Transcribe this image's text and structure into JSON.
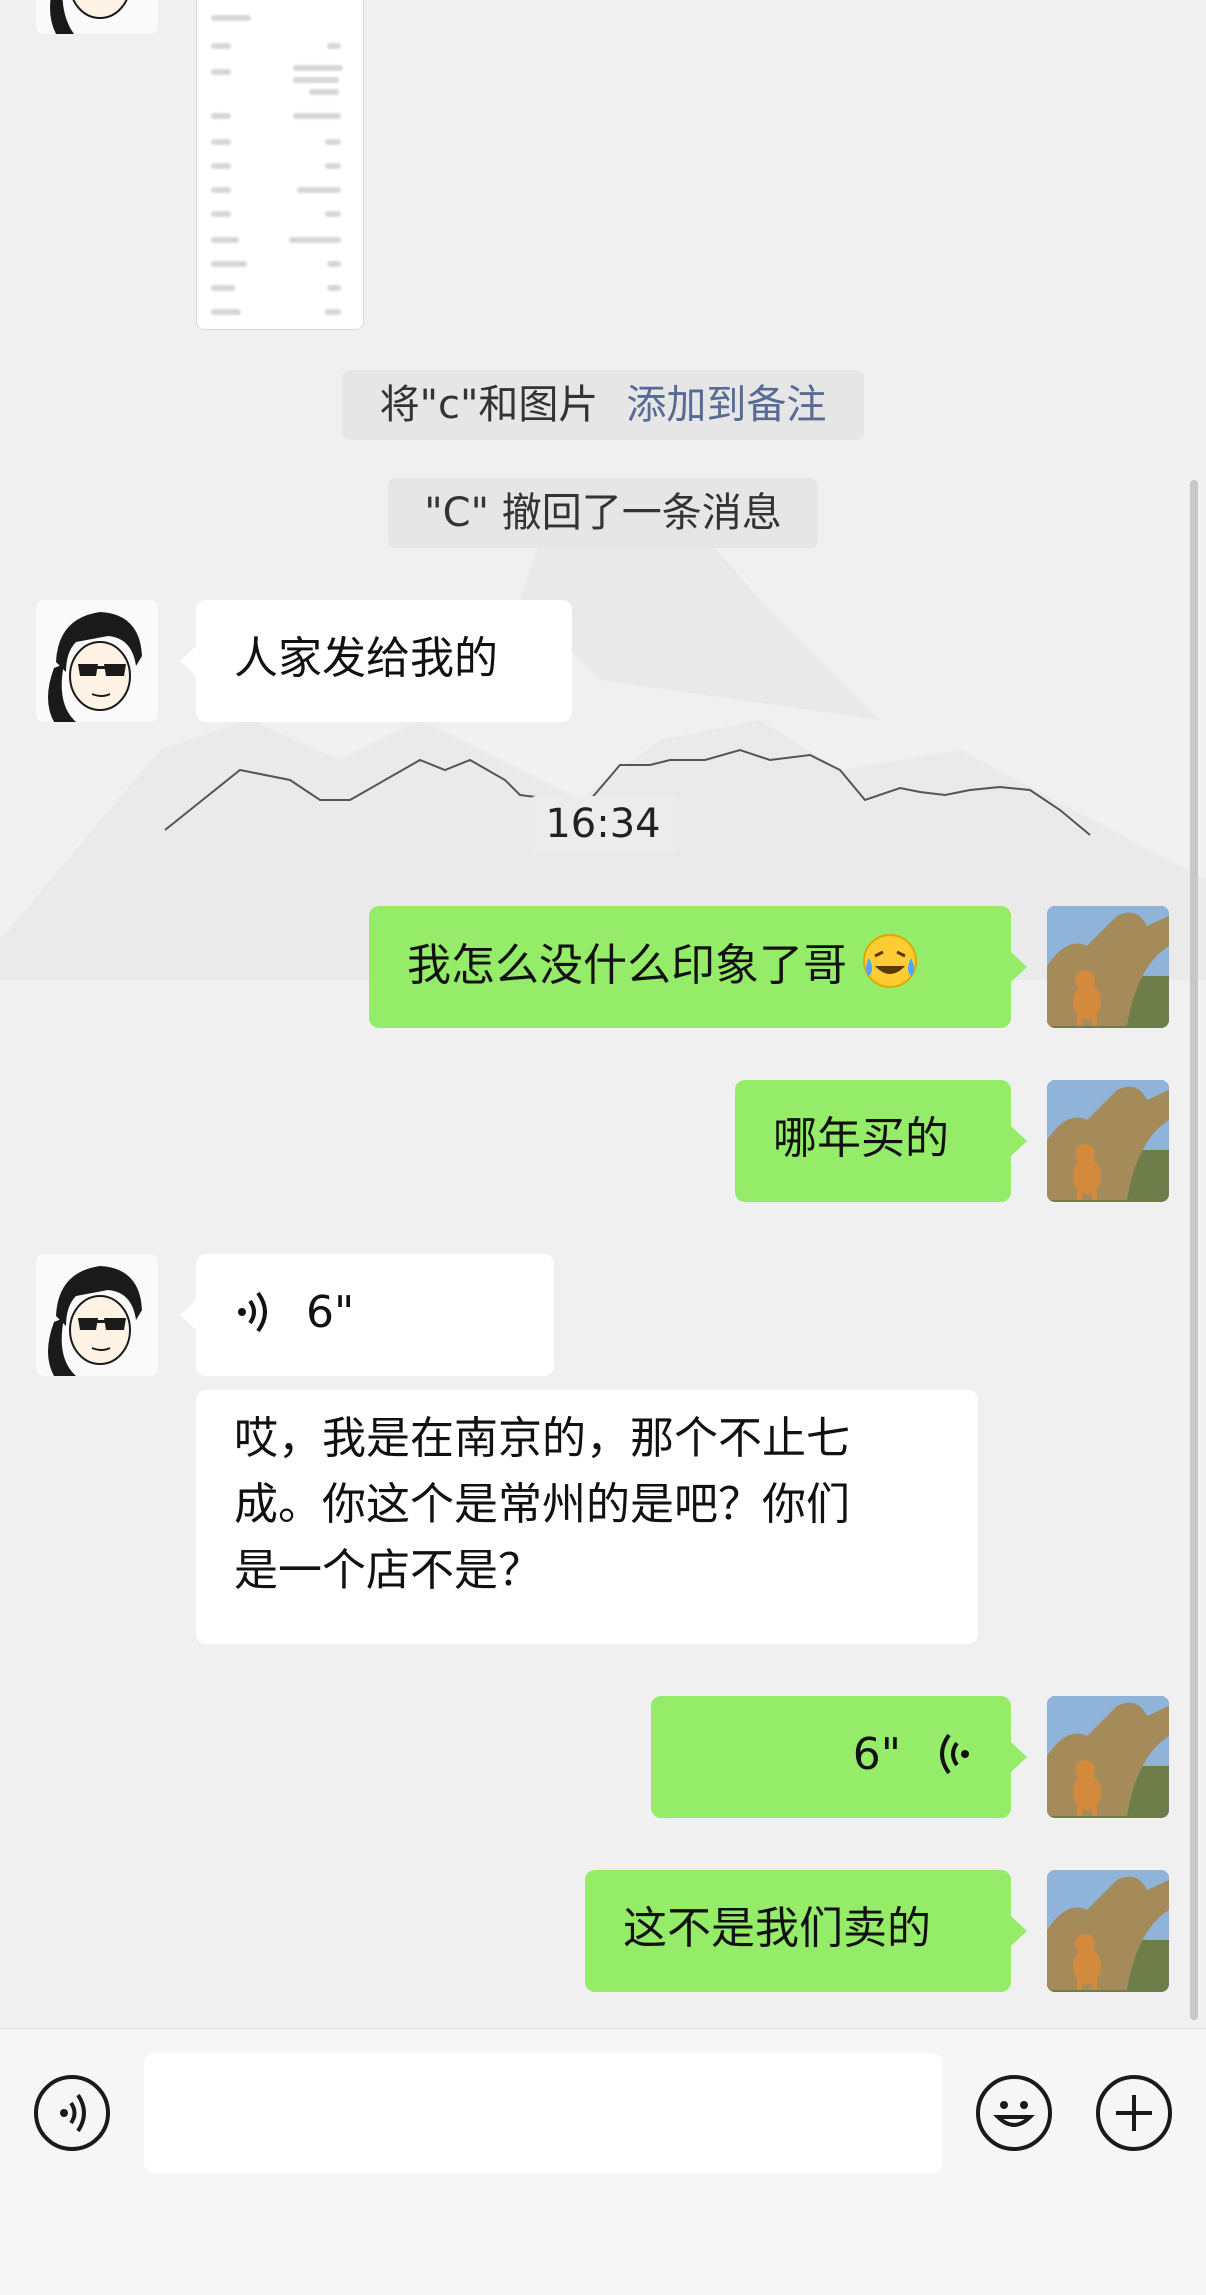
{
  "system": {
    "remark_prefix": "将\"c\"和图片",
    "remark_link": "添加到备注",
    "recalled": "\"C\" 撤回了一条消息",
    "timestamp": "16:34"
  },
  "messages": [
    {
      "from": "other",
      "type": "text",
      "text": "人家发给我的"
    },
    {
      "from": "me",
      "type": "text",
      "text": "我怎么没什么印象了哥",
      "emoji": "crying-laughing-emoji"
    },
    {
      "from": "me",
      "type": "text",
      "text": "哪年买的"
    },
    {
      "from": "other",
      "type": "voice",
      "duration": "6\""
    },
    {
      "from": "other",
      "type": "text",
      "lines": [
        "哎，我是在南京的，那个不止七",
        "成。你这个是常州的是吧？你们",
        "是一个店不是？"
      ]
    },
    {
      "from": "me",
      "type": "voice",
      "duration": "6\""
    },
    {
      "from": "me",
      "type": "text",
      "text": "这不是我们卖的"
    }
  ],
  "input": {
    "placeholder": "",
    "value": ""
  },
  "icons": {
    "voice_toggle": "voice-icon",
    "emoji": "smiley-icon",
    "more": "plus-icon"
  },
  "colors": {
    "background": "#f0f0f0",
    "my_bubble": "#95ec69",
    "their_bubble": "#ffffff",
    "link": "#576b95"
  }
}
